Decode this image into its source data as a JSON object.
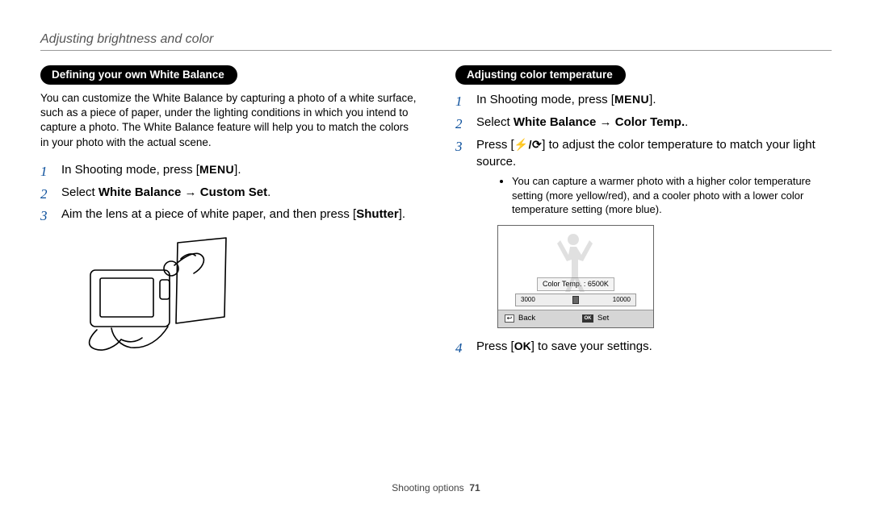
{
  "header": "Adjusting brightness and color",
  "footer": {
    "section": "Shooting options",
    "page": "71"
  },
  "left": {
    "pill": "Defining your own White Balance",
    "intro": "You can customize the White Balance by capturing a photo of a white surface, such as a piece of paper, under the lighting conditions in which you intend to capture a photo. The White Balance feature will help you to match the colors in your photo with the actual scene.",
    "steps": {
      "s1a": "In Shooting mode, press [",
      "s1_menu": "MENU",
      "s1b": "].",
      "s2a": "Select ",
      "s2b": "White Balance",
      "s2arrow": " → ",
      "s2c": "Custom Set",
      "s2d": ".",
      "s3a": "Aim the lens at a piece of white paper, and then press [",
      "s3b": "Shutter",
      "s3c": "]."
    }
  },
  "right": {
    "pill": "Adjusting color temperature",
    "steps": {
      "s1a": "In Shooting mode, press [",
      "s1_menu": "MENU",
      "s1b": "].",
      "s2a": "Select ",
      "s2b": "White Balance",
      "s2arrow": " → ",
      "s2c": "Color Temp.",
      "s2d": ".",
      "s3a": "Press [",
      "s3_icons": "⚡/⟳",
      "s3b": "] to adjust the color temperature to match your light source.",
      "bullet": "You can capture a warmer photo with a higher color temperature setting (more yellow/red), and a cooler photo with a lower color temperature setting (more blue).",
      "s4a": "Press [",
      "s4_ok": "OK",
      "s4b": "] to save your settings."
    },
    "lcd": {
      "label": "Color Temp. : 6500K",
      "min": "3000",
      "max": "10000",
      "back": "Back",
      "set": "Set"
    }
  }
}
